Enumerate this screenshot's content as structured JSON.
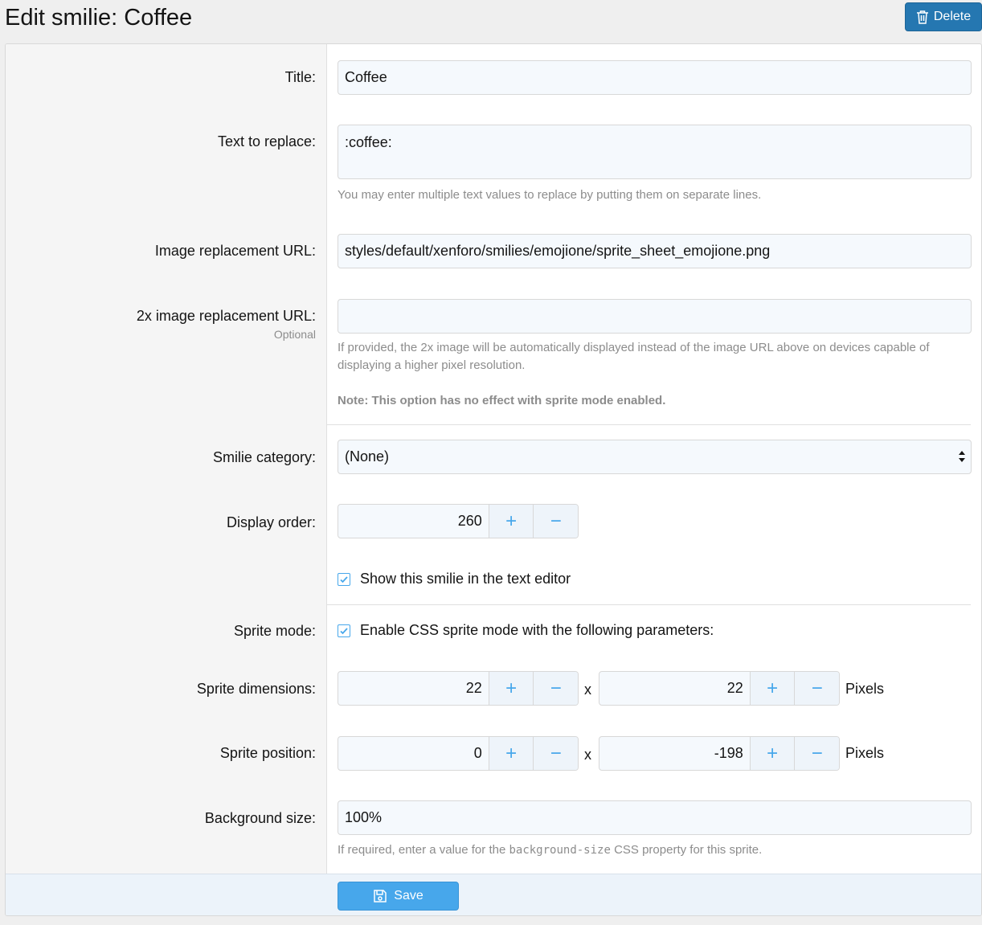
{
  "header": {
    "title": "Edit smilie: Coffee",
    "delete_label": "Delete",
    "delete_icon": "trash-icon"
  },
  "form": {
    "title": {
      "label": "Title:",
      "value": "Coffee"
    },
    "text_replace": {
      "label": "Text to replace:",
      "value": ":coffee:",
      "hint": "You may enter multiple text values to replace by putting them on separate lines."
    },
    "image_url": {
      "label": "Image replacement URL:",
      "value": "styles/default/xenforo/smilies/emojione/sprite_sheet_emojione.png"
    },
    "image_url_2x": {
      "label": "2x image replacement URL:",
      "sublabel": "Optional",
      "value": "",
      "hint": "If provided, the 2x image will be automatically displayed instead of the image URL above on devices capable of displaying a higher pixel resolution.",
      "note": "Note: This option has no effect with sprite mode enabled."
    },
    "category": {
      "label": "Smilie category:",
      "value": "(None)"
    },
    "display_order": {
      "label": "Display order:",
      "value": "260"
    },
    "show_in_editor": {
      "label": "Show this smilie in the text editor",
      "checked": true
    },
    "sprite_mode": {
      "label": "Sprite mode:",
      "checkbox_label": "Enable CSS sprite mode with the following parameters:",
      "checked": true
    },
    "sprite_dimensions": {
      "label": "Sprite dimensions:",
      "width": "22",
      "height": "22",
      "separator": "x",
      "unit": "Pixels"
    },
    "sprite_position": {
      "label": "Sprite position:",
      "x": "0",
      "y": "-198",
      "separator": "x",
      "unit": "Pixels"
    },
    "background_size": {
      "label": "Background size:",
      "value": "100%",
      "hint_before": "If required, enter a value for the ",
      "hint_code": "background-size",
      "hint_after": " CSS property for this sprite."
    },
    "spinner_plus": "+",
    "spinner_minus": "−"
  },
  "footer": {
    "save_label": "Save",
    "save_icon": "save-icon"
  },
  "colors": {
    "accent": "#47a7eb",
    "delete_button": "#2577b1",
    "label_column": "#f5f5f5",
    "footer": "#ecf3fa"
  }
}
